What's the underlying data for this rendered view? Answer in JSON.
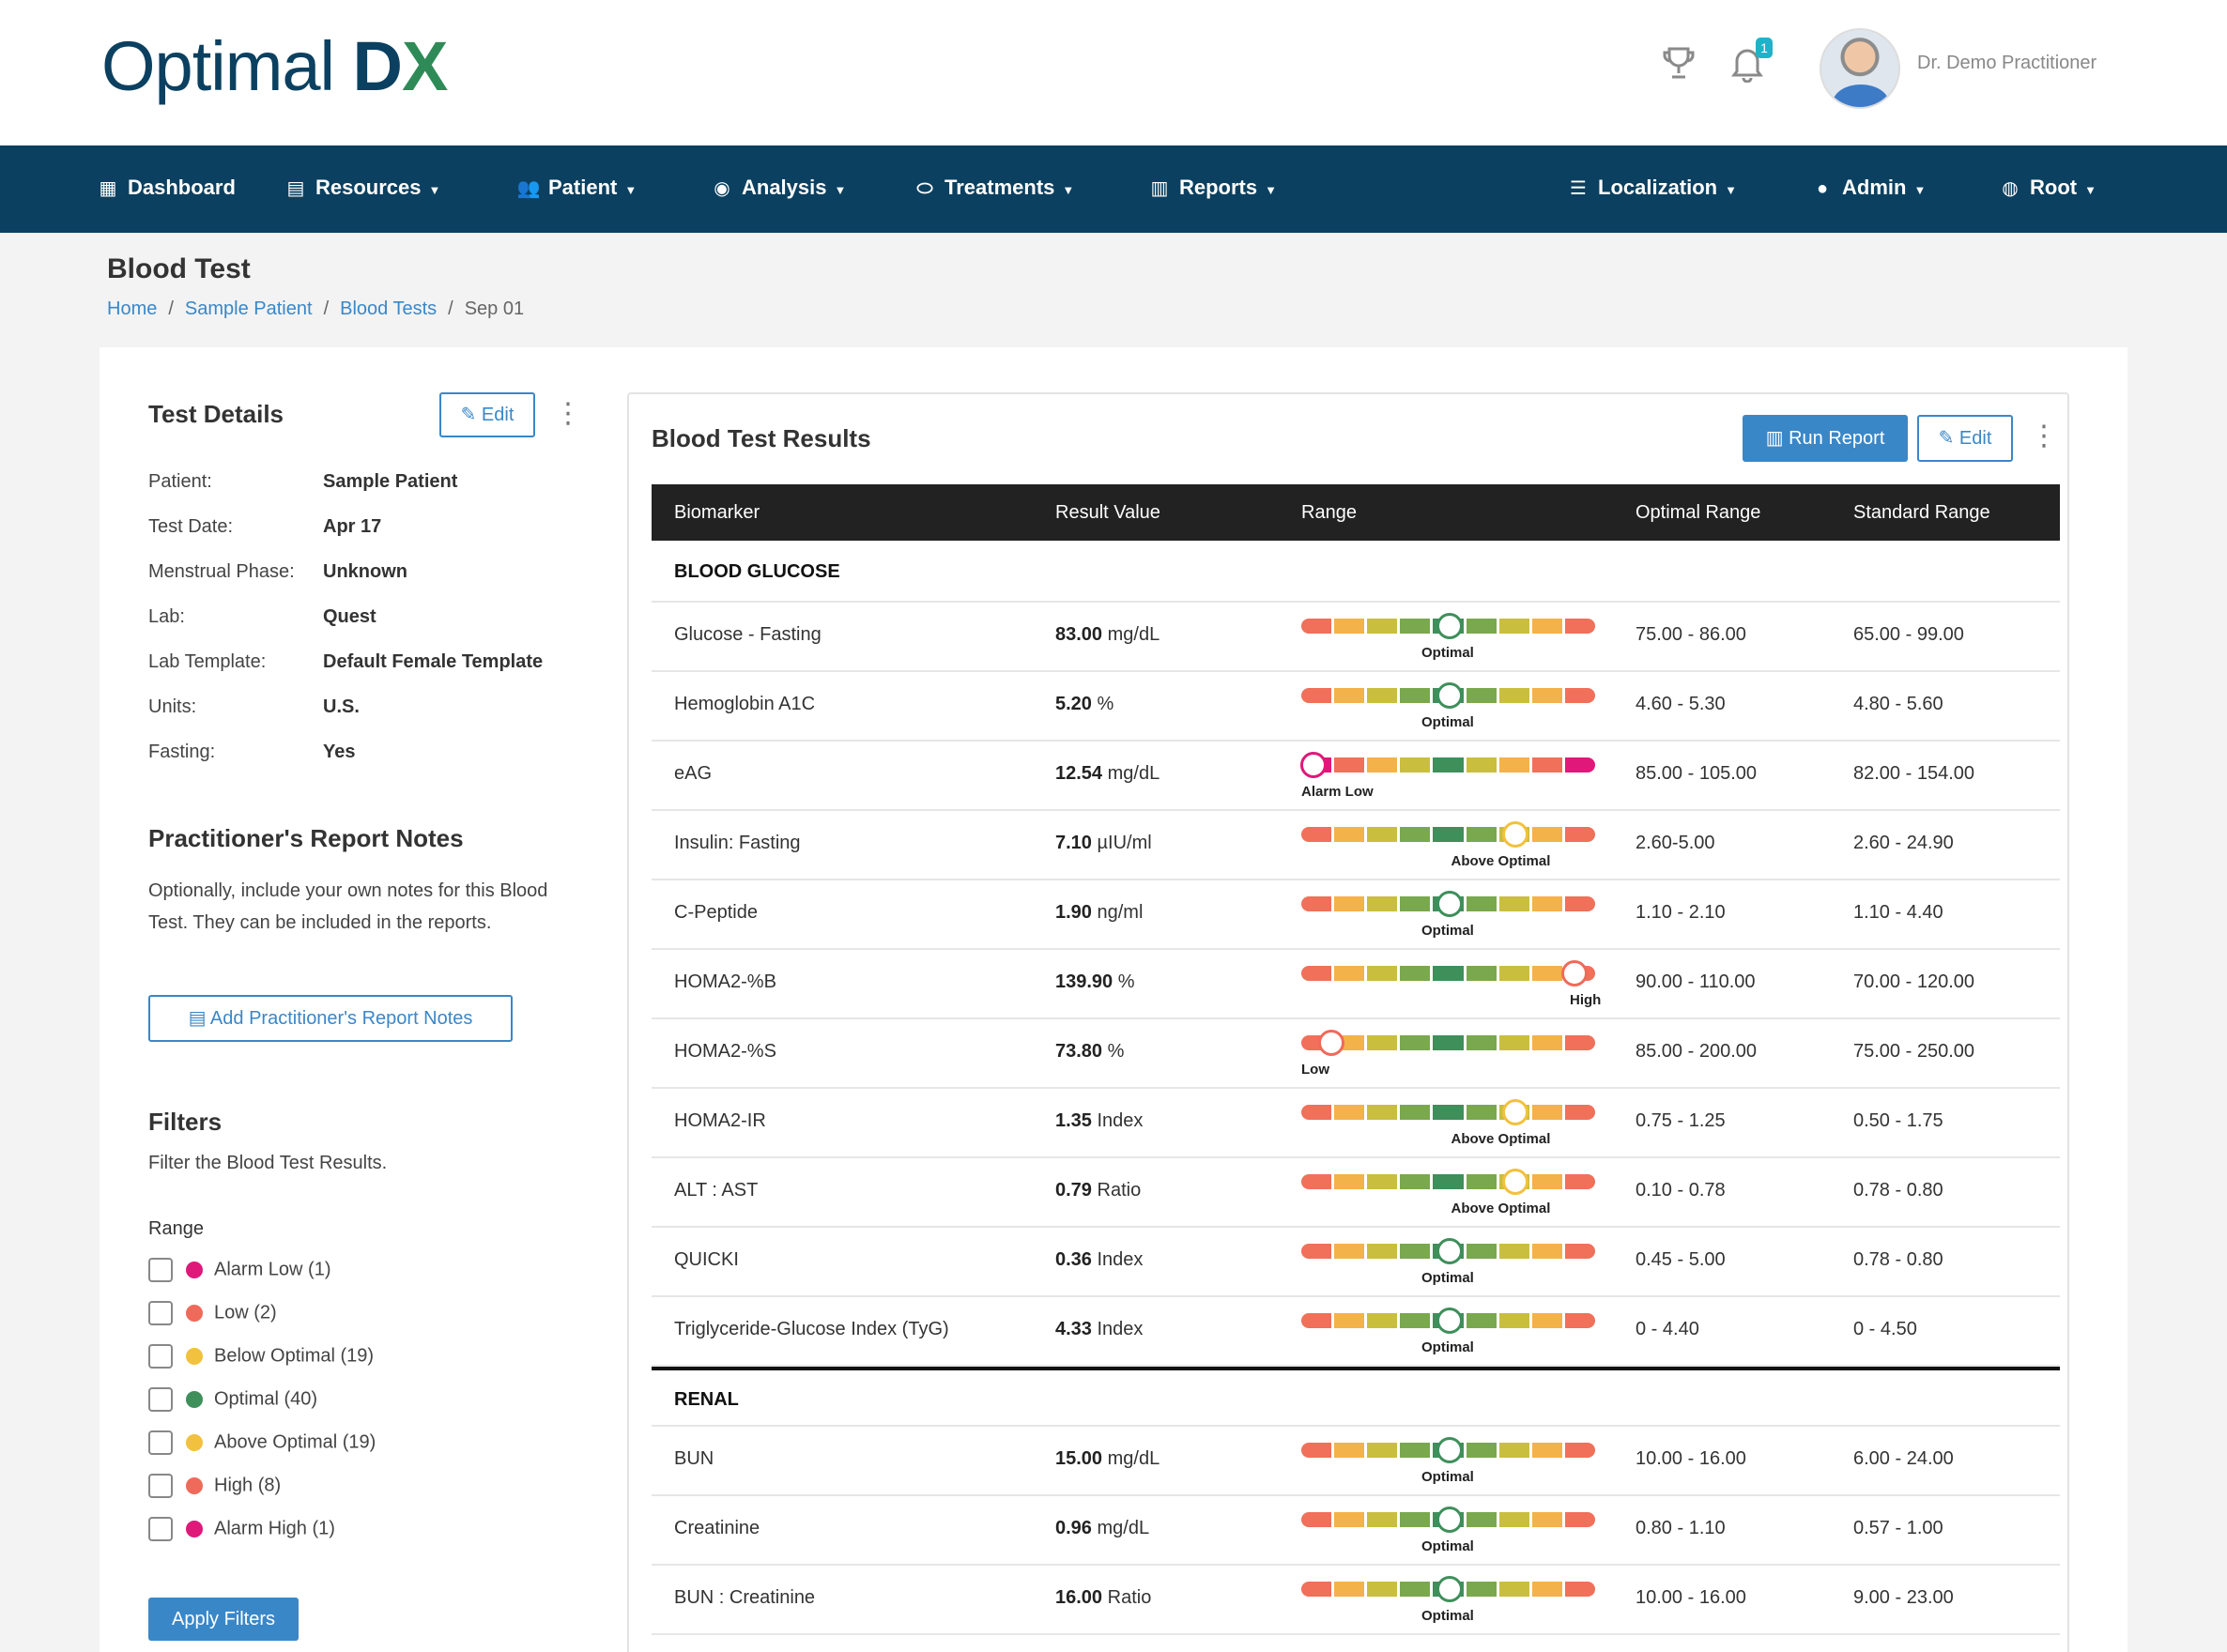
{
  "app": {
    "logo_text": "Optimal",
    "logo_dx": "D",
    "logo_x": "X",
    "notification_count": "1",
    "user_name": "Dr. Demo Practitioner"
  },
  "nav": {
    "dashboard": "Dashboard",
    "resources": "Resources",
    "patient": "Patient",
    "analysis": "Analysis",
    "treatments": "Treatments",
    "reports": "Reports",
    "localization": "Localization",
    "admin": "Admin",
    "root": "Root"
  },
  "page": {
    "title": "Blood Test",
    "breadcrumb": [
      "Home",
      "Sample Patient",
      "Blood Tests",
      "Sep 01"
    ]
  },
  "details": {
    "title": "Test Details",
    "edit_label": "Edit",
    "fields": [
      {
        "label": "Patient:",
        "value": "Sample Patient"
      },
      {
        "label": "Test Date:",
        "value": "Apr 17"
      },
      {
        "label": "Menstrual Phase:",
        "value": "Unknown"
      },
      {
        "label": "Lab:",
        "value": "Quest"
      },
      {
        "label": "Lab Template:",
        "value": "Default Female Template"
      },
      {
        "label": "Units:",
        "value": "U.S."
      },
      {
        "label": "Fasting:",
        "value": "Yes"
      }
    ]
  },
  "notes": {
    "title": "Practitioner's Report Notes",
    "description": "Optionally, include your own notes for this Blood Test. They can be included in the reports.",
    "add_label": "Add Practitioner's Report Notes"
  },
  "filters": {
    "title": "Filters",
    "description": "Filter the Blood Test Results.",
    "range_label": "Range",
    "options": [
      {
        "label": "Alarm Low (1)",
        "color": "#e0187a"
      },
      {
        "label": "Low (2)",
        "color": "#ef6a5a"
      },
      {
        "label": "Below Optimal (19)",
        "color": "#f2c13d"
      },
      {
        "label": "Optimal (40)",
        "color": "#3f8f5b"
      },
      {
        "label": "Above Optimal (19)",
        "color": "#f2c13d"
      },
      {
        "label": "High (8)",
        "color": "#ef6a5a"
      },
      {
        "label": "Alarm High (1)",
        "color": "#e0187a"
      }
    ],
    "apply_label": "Apply Filters"
  },
  "results": {
    "title": "Blood Test Results",
    "run_report_label": "Run Report",
    "edit_label": "Edit",
    "columns": [
      "Biomarker",
      "Result Value",
      "Range",
      "Optimal Range",
      "Standard Range"
    ],
    "groups": [
      {
        "name": "BLOOD GLUCOSE",
        "rows": [
          {
            "biomarker": "Glucose - Fasting",
            "value": "83.00",
            "unit": "mg/dL",
            "status": "Optimal",
            "position": 0.5,
            "optimal": "75.00 - 86.00",
            "standard": "65.00 - 99.00"
          },
          {
            "biomarker": "Hemoglobin A1C",
            "value": "5.20",
            "unit": "%",
            "status": "Optimal",
            "position": 0.5,
            "optimal": "4.60 - 5.30",
            "standard": "4.80 - 5.60"
          },
          {
            "biomarker": "eAG",
            "value": "12.54",
            "unit": "mg/dL",
            "status": "Alarm Low",
            "position": 0.04,
            "optimal": "85.00 - 105.00",
            "standard": "82.00 - 154.00"
          },
          {
            "biomarker": "Insulin: Fasting",
            "value": "7.10",
            "unit": "µIU/ml",
            "status": "Above Optimal",
            "position": 0.72,
            "optimal": "2.60-5.00",
            "standard": "2.60 - 24.90"
          },
          {
            "biomarker": "C-Peptide",
            "value": "1.90",
            "unit": "ng/ml",
            "status": "Optimal",
            "position": 0.5,
            "optimal": "1.10 - 2.10",
            "standard": "1.10 - 4.40"
          },
          {
            "biomarker": "HOMA2-%B",
            "value": "139.90",
            "unit": "%",
            "status": "High",
            "position": 0.92,
            "optimal": "90.00 - 110.00",
            "standard": "70.00 - 120.00"
          },
          {
            "biomarker": "HOMA2-%S",
            "value": "73.80",
            "unit": "%",
            "status": "Low",
            "position": 0.1,
            "optimal": "85.00 - 200.00",
            "standard": "75.00 - 250.00"
          },
          {
            "biomarker": "HOMA2-IR",
            "value": "1.35",
            "unit": "Index",
            "status": "Above Optimal",
            "position": 0.72,
            "optimal": "0.75 - 1.25",
            "standard": "0.50 - 1.75"
          },
          {
            "biomarker": "ALT : AST",
            "value": "0.79",
            "unit": "Ratio",
            "status": "Above Optimal",
            "position": 0.72,
            "optimal": "0.10 - 0.78",
            "standard": "0.78 - 0.80"
          },
          {
            "biomarker": "QUICKI",
            "value": "0.36",
            "unit": "Index",
            "status": "Optimal",
            "position": 0.5,
            "optimal": "0.45 - 5.00",
            "standard": "0.78 - 0.80"
          },
          {
            "biomarker": "Triglyceride-Glucose Index (TyG)",
            "value": "4.33",
            "unit": "Index",
            "status": "Optimal",
            "position": 0.5,
            "optimal": "0 - 4.40",
            "standard": "0 - 4.50"
          }
        ]
      },
      {
        "name": "RENAL",
        "rows": [
          {
            "biomarker": "BUN",
            "value": "15.00",
            "unit": "mg/dL",
            "status": "Optimal",
            "position": 0.5,
            "optimal": "10.00 - 16.00",
            "standard": "6.00 - 24.00"
          },
          {
            "biomarker": "Creatinine",
            "value": "0.96",
            "unit": "mg/dL",
            "status": "Optimal",
            "position": 0.5,
            "optimal": "0.80 - 1.10",
            "standard": "0.57 - 1.00"
          },
          {
            "biomarker": "BUN : Creatinine",
            "value": "16.00",
            "unit": "Ratio",
            "status": "Optimal",
            "position": 0.5,
            "optimal": "10.00 - 16.00",
            "standard": "9.00 - 23.00"
          }
        ]
      }
    ]
  }
}
